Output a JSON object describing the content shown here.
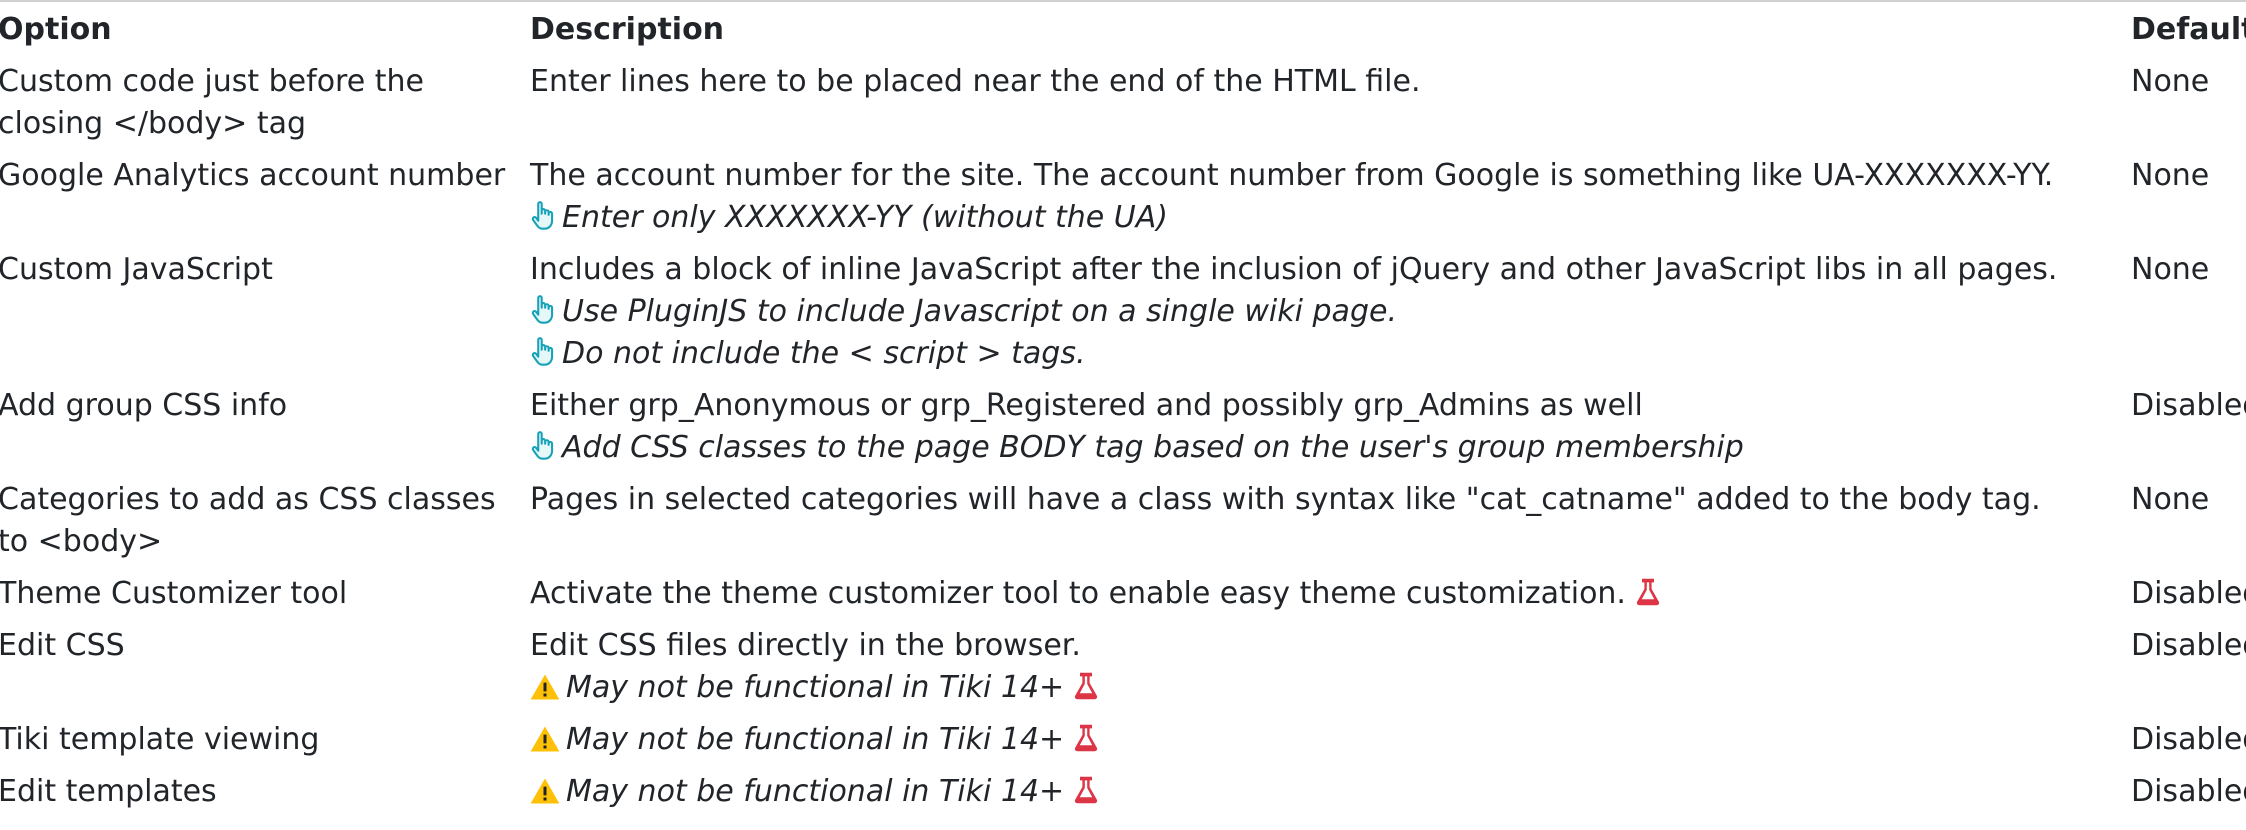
{
  "table": {
    "headers": {
      "option": "Option",
      "description": "Description",
      "default": "Default"
    },
    "rows": [
      {
        "option": "Custom code just before the closing </body> tag",
        "description": "Enter lines here to be placed near the end of the HTML file.",
        "default": "None"
      },
      {
        "option": "Google Analytics account number",
        "description": "The account number for the site. The account number from Google is something like UA-XXXXXXX-YY.",
        "notes": [
          "Enter only XXXXXXX-YY (without the UA)"
        ],
        "default": "None"
      },
      {
        "option": "Custom JavaScript",
        "description": "Includes a block of inline JavaScript after the inclusion of jQuery and other JavaScript libs in all pages.",
        "notes": [
          "Use PluginJS to include Javascript on a single wiki page.",
          "Do not include the < script > tags."
        ],
        "default": "None"
      },
      {
        "option": "Add group CSS info",
        "description": "Either grp_Anonymous or grp_Registered and possibly grp_Admins as well",
        "notes": [
          "Add CSS classes to the page BODY tag based on the user's group membership"
        ],
        "default": "Disabled"
      },
      {
        "option": "Categories to add as CSS classes to <body>",
        "description": "Pages in selected categories will have a class with syntax like \"cat_catname\" added to the body tag.",
        "default": "None"
      },
      {
        "option": "Theme Customizer tool",
        "description": "Activate the theme customizer tool to enable easy theme customization.",
        "default": "Disabled"
      },
      {
        "option": "Edit CSS",
        "description": "Edit CSS files directly in the browser.",
        "warning": "May not be functional in Tiki 14+",
        "default": "Disabled"
      },
      {
        "option": "Tiki template viewing",
        "warning": "May not be functional in Tiki 14+",
        "default": "Disabled"
      },
      {
        "option": "Edit templates",
        "warning": "May not be functional in Tiki 14+",
        "default": "Disabled"
      }
    ]
  },
  "icons": {
    "tip": "pointing-hand-icon",
    "warning": "warning-icon",
    "experimental": "flask-icon"
  },
  "colors": {
    "tip_icon": "#17a2b8",
    "warning_icon": "#ffc107",
    "experimental_icon": "#dc3545"
  }
}
